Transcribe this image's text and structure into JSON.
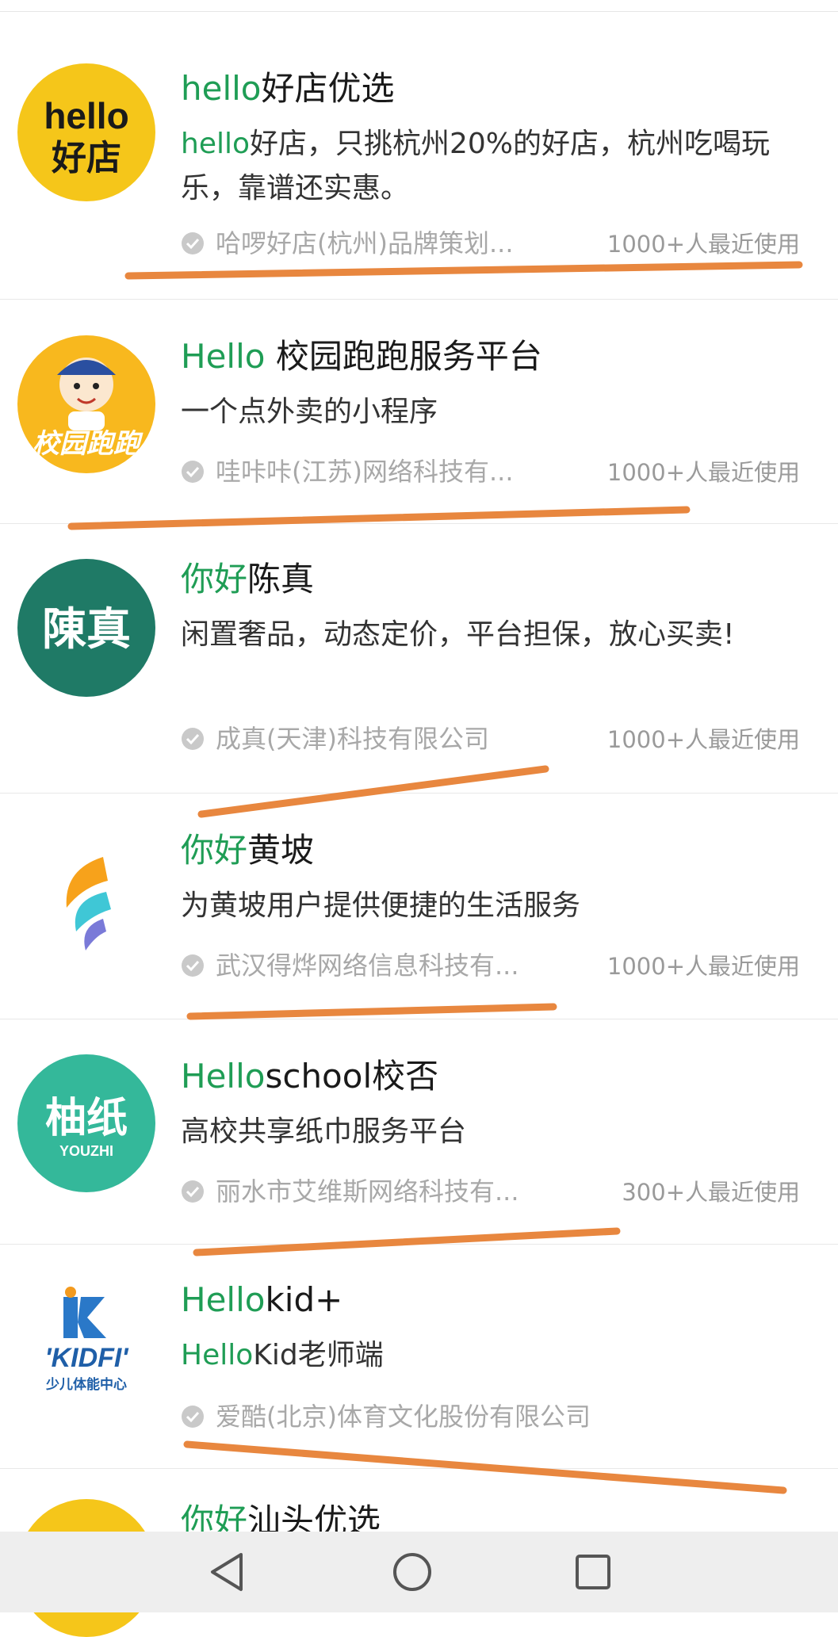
{
  "items": [
    {
      "title_hl": "hello",
      "title_rest": "好店优选",
      "desc_hl": "hello",
      "desc_rest": "好店，只挑杭州20%的好店，杭州吃喝玩乐，靠谱还实惠。",
      "company": "哈啰好店(杭州)品牌策划...",
      "usage": "1000+人最近使用",
      "logo_text": [
        "hello",
        "好店"
      ]
    },
    {
      "title_hl": "Hello",
      "title_rest": " 校园跑跑服务平台",
      "desc_hl": "",
      "desc_rest": "一个点外卖的小程序",
      "company": "哇咔咔(江苏)网络科技有...",
      "usage": "1000+人最近使用",
      "logo_text": [
        "校园跑跑"
      ]
    },
    {
      "title_hl": "你好",
      "title_rest": "陈真",
      "desc_hl": "",
      "desc_rest": "闲置奢品，动态定价，平台担保，放心买卖!",
      "company": "成真(天津)科技有限公司",
      "usage": "1000+人最近使用",
      "logo_text": [
        "陳真"
      ]
    },
    {
      "title_hl": "你好",
      "title_rest": "黄坡",
      "desc_hl": "",
      "desc_rest": "为黄坡用户提供便捷的生活服务",
      "company": "武汉得烨网络信息科技有...",
      "usage": "1000+人最近使用",
      "logo_text": []
    },
    {
      "title_hl": "Hello",
      "title_rest": "school校否",
      "desc_hl": "",
      "desc_rest": "高校共享纸巾服务平台",
      "company": "丽水市艾维斯网络科技有...",
      "usage": "300+人最近使用",
      "logo_text": [
        "柚纸",
        "YOUZHI"
      ]
    },
    {
      "title_hl": "Hello",
      "title_rest": "kid+",
      "desc_hl": "Hello",
      "desc_rest": "Kid老师端",
      "company": "爱酷(北京)体育文化股份有限公司",
      "usage": "",
      "logo_text": [
        "'KIDFI'",
        "少儿体能中心"
      ]
    },
    {
      "title_hl": "你好",
      "title_rest": "汕头优选",
      "desc_hl": "",
      "desc_rest": "",
      "company": "",
      "usage": "",
      "logo_text": []
    }
  ],
  "colors": {
    "highlight": "#1f9d55",
    "annotation": "#e8873f"
  },
  "nav": {
    "icons": [
      "back-triangle-icon",
      "home-circle-icon",
      "recents-square-icon"
    ]
  }
}
